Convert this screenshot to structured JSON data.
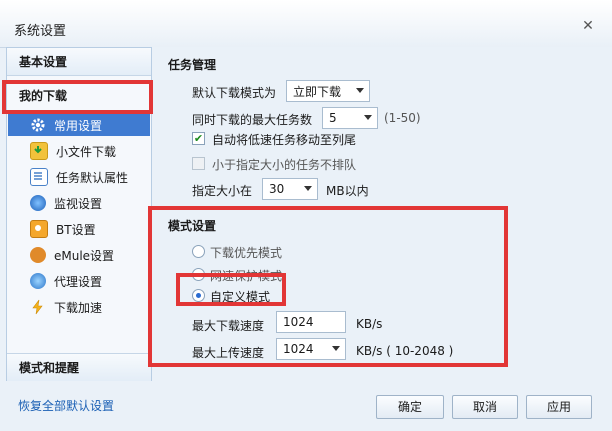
{
  "window": {
    "title": "系统设置",
    "close_glyph": "✕"
  },
  "nav": {
    "header_basic": "基本设置",
    "header_download": "我的下载",
    "items": [
      {
        "label": "常用设置",
        "icon": "gear-icon",
        "selected": true
      },
      {
        "label": "小文件下载",
        "icon": "small-file-download-icon"
      },
      {
        "label": "任务默认属性",
        "icon": "task-properties-icon"
      },
      {
        "label": "监视设置",
        "icon": "monitor-icon"
      },
      {
        "label": "BT设置",
        "icon": "bt-icon"
      },
      {
        "label": "eMule设置",
        "icon": "emule-icon"
      },
      {
        "label": "代理设置",
        "icon": "proxy-icon"
      },
      {
        "label": "下载加速",
        "icon": "lightning-icon"
      }
    ],
    "header_mode": "模式和提醒"
  },
  "task": {
    "title": "任务管理",
    "default_mode_label": "默认下载模式为",
    "default_mode_value": "立即下载",
    "max_tasks_label": "同时下载的最大任务数",
    "max_tasks_value": "5",
    "max_tasks_range": "(1-50)",
    "auto_move_label": "自动将低速任务移动至列尾",
    "auto_move_checked": true,
    "skip_small_label": "小于指定大小的任务不排队",
    "skip_small_checked": false,
    "size_label": "指定大小在",
    "size_value": "30",
    "size_unit": "MB以内"
  },
  "mode": {
    "title": "模式设置",
    "options": [
      {
        "label": "下载优先模式",
        "checked": false
      },
      {
        "label": "网速保护模式",
        "checked": false
      },
      {
        "label": "自定义模式",
        "checked": true
      }
    ],
    "max_down_label": "最大下载速度",
    "max_down_value": "1024",
    "max_down_unit": "KB/s",
    "max_up_label": "最大上传速度",
    "max_up_value": "1024",
    "max_up_unit": "KB/s ( 10-2048 )"
  },
  "footer": {
    "restore_defaults": "恢复全部默认设置",
    "ok": "确定",
    "cancel": "取消",
    "apply": "应用"
  },
  "colors": {
    "accent": "#3f7bd1",
    "annotation_red": "#e23636"
  }
}
